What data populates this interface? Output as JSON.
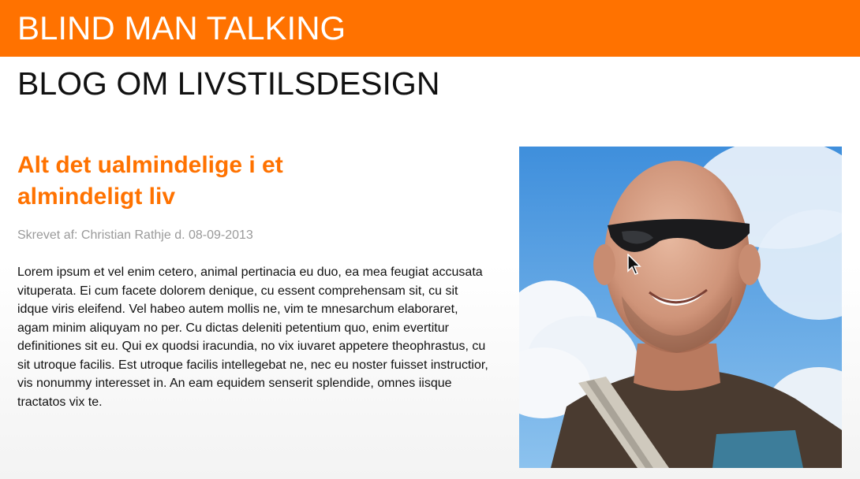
{
  "header": {
    "site_title": "BLIND MAN TALKING",
    "subtitle": "BLOG OM LIVSTILSDESIGN"
  },
  "article": {
    "title": "Alt det ualmindelige i et almindeligt liv",
    "byline": "Skrevet af: Christian Rathje d. 08-09-2013",
    "body": "Lorem ipsum et vel enim cetero, animal pertinacia eu duo, ea mea feugiat accusata vituperata. Ei cum facete dolorem denique, cu essent comprehensam sit, cu sit idque viris eleifend. Vel habeo autem mollis ne, vim te mnesarchum elaboraret, agam minim aliquyam no per. Cu dictas deleniti petentium quo, enim evertitur definitiones sit eu. Qui ex quodsi iracundia, no vix iuvaret appetere theophrastus, cu sit utroque facilis. Est utroque facilis intellegebat ne, nec eu noster fuisset instructior, vis nonummy interesset in. An eam equidem senserit splendide, omnes iisque tractatos vix te."
  },
  "photo": {
    "icon": "author-portrait-photo"
  },
  "colors": {
    "brand": "#ff7200",
    "text": "#111111",
    "muted": "#9a9a9a"
  }
}
